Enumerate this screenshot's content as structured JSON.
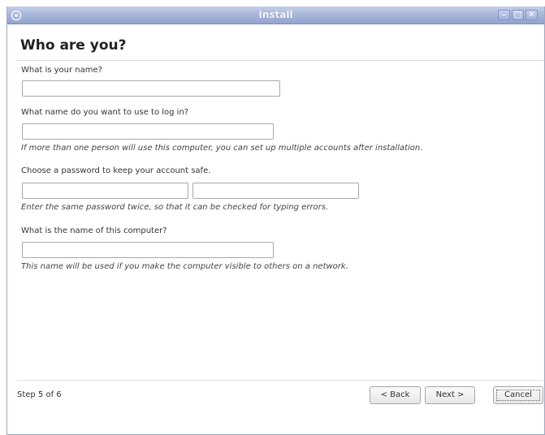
{
  "window": {
    "title": "Install",
    "controls": {
      "minimize": "‒",
      "maximize": "□",
      "close": "✕"
    },
    "colors": {
      "titlebar": "#a6b4d8",
      "title_text": "#f4f6fb"
    }
  },
  "page": {
    "title": "Who are you?",
    "name_question": "What is your name?",
    "name_value": "",
    "login_question": "What name do you want to use to log in?",
    "login_value": "",
    "login_hint": "If more than one person will use this computer, you can set up multiple accounts after installation.",
    "password_question": "Choose a password to keep your account safe.",
    "password_value": "",
    "password_confirm_value": "",
    "password_hint": "Enter the same password twice, so that it can be checked for typing errors.",
    "computer_question": "What is the name of this computer?",
    "computer_value": "",
    "computer_hint": "This name will be used if you make the computer visible to others on a network."
  },
  "footer": {
    "step": "Step 5 of 6",
    "back_label": "< Back",
    "next_label": "Next >",
    "cancel_label": "Cancel"
  }
}
